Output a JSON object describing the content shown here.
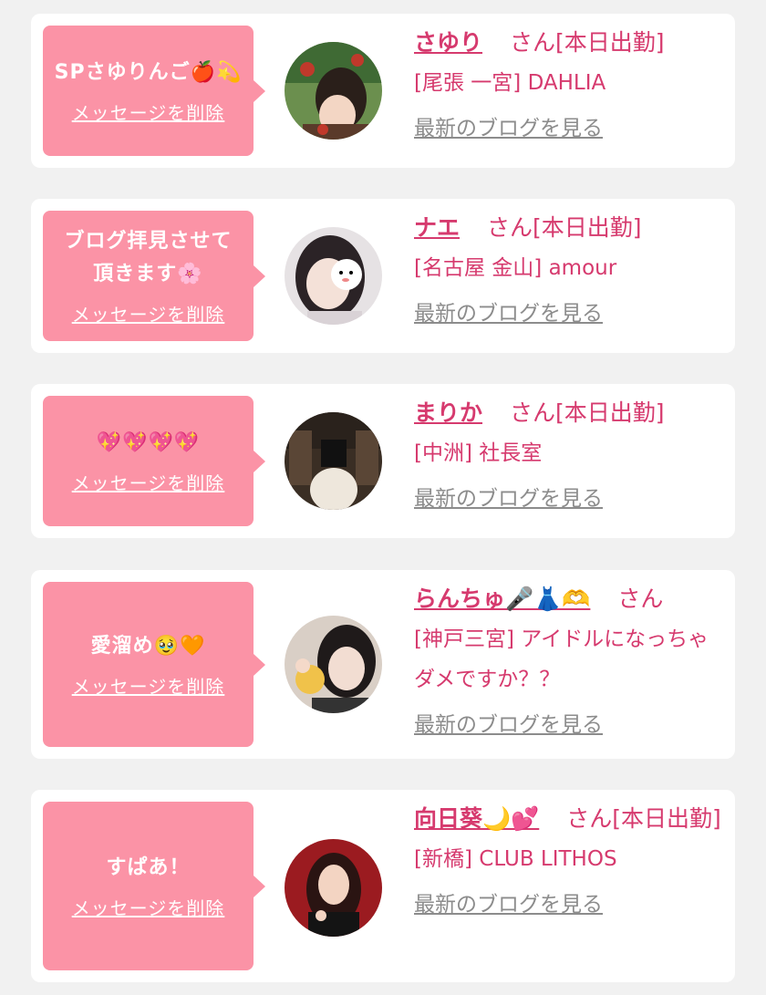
{
  "items": [
    {
      "message": "SPさゆりんご🍎💫",
      "delete_label": "メッセージを削除",
      "name": "さゆり",
      "honorific": "さん[本日出勤]",
      "shop": "[尾張 一宮] DAHLIA",
      "blog_link": "最新のブログを見る"
    },
    {
      "message": "ブログ拝見させて頂きます🌸",
      "delete_label": "メッセージを削除",
      "name": "ナエ",
      "honorific": "さん[本日出勤]",
      "shop": "[名古屋 金山] amour",
      "blog_link": "最新のブログを見る"
    },
    {
      "message": "💖💖💖💖",
      "delete_label": "メッセージを削除",
      "name": "まりか",
      "honorific": "さん[本日出勤]",
      "shop": "[中洲] 社長室",
      "blog_link": "最新のブログを見る"
    },
    {
      "message": "愛溜め🥹🧡",
      "delete_label": "メッセージを削除",
      "name": "らんちゅ🎤👗🫶",
      "honorific": "さん",
      "shop": "[神戸三宮] アイドルになっちゃダメですか？？",
      "blog_link": "最新のブログを見る"
    },
    {
      "message": "すぱあ！",
      "delete_label": "メッセージを削除",
      "name": "向日葵🌙💕",
      "honorific": "さん[本日出勤]",
      "shop": "[新橋] CLUB LITHOS",
      "blog_link": "最新のブログを見る"
    }
  ],
  "colors": {
    "bubble": "#fb93a6",
    "accent": "#d63a6e",
    "link_gray": "#8c8c8c",
    "background": "#f1f1f1"
  }
}
